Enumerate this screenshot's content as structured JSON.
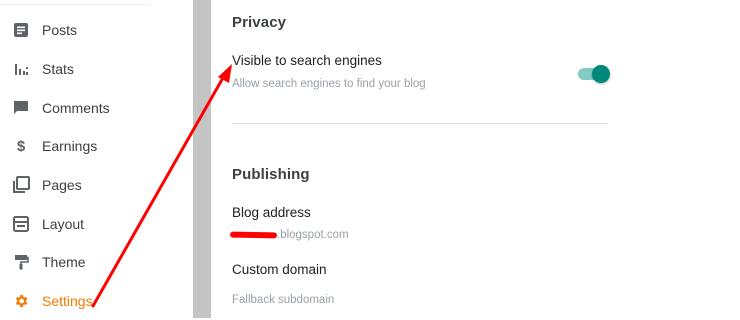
{
  "sidebar": {
    "items": [
      {
        "label": "Posts",
        "icon": "posts-icon"
      },
      {
        "label": "Stats",
        "icon": "stats-icon"
      },
      {
        "label": "Comments",
        "icon": "comments-icon"
      },
      {
        "label": "Earnings",
        "icon": "dollar-icon"
      },
      {
        "label": "Pages",
        "icon": "pages-icon"
      },
      {
        "label": "Layout",
        "icon": "layout-icon"
      },
      {
        "label": "Theme",
        "icon": "paint-roller-icon"
      },
      {
        "label": "Settings",
        "icon": "gear-icon",
        "active": true
      }
    ]
  },
  "privacy": {
    "title": "Privacy",
    "visible": {
      "label": "Visible to search engines",
      "description": "Allow search engines to find your blog",
      "enabled": true
    }
  },
  "publishing": {
    "title": "Publishing",
    "blog_address": {
      "label": "Blog address",
      "value_suffix": ".blogspot.com"
    },
    "custom_domain": {
      "label": "Custom domain",
      "placeholder": "Fallback subdomain"
    }
  },
  "colors": {
    "accent": "#f57c00",
    "toggle_on": "#00897b",
    "annotation": "#ff0000",
    "divider": "#c4c4c4"
  }
}
